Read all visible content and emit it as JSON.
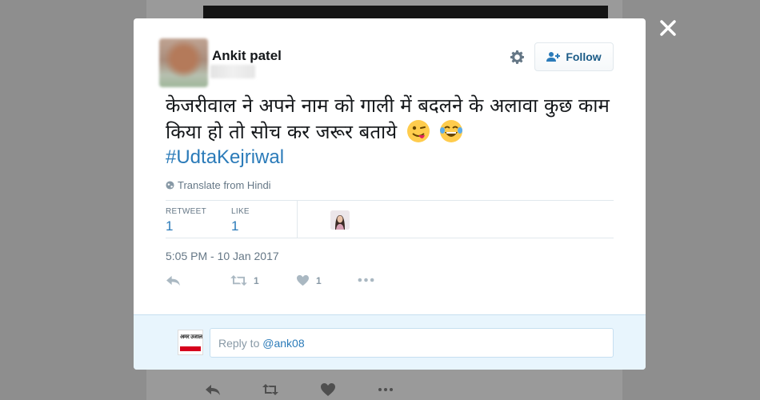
{
  "tweet": {
    "author_name": "Ankit patel",
    "follow_label": "Follow",
    "text": "केजरीवाल ने अपने नाम को गाली में बदलने के अलावा कुछ काम किया हो तो सोच कर जरूर बताये",
    "emojis": [
      "winking-tongue-emoji",
      "tears-of-joy-emoji"
    ],
    "hashtag": "#UdtaKejriwal",
    "translate_label": "Translate from Hindi",
    "stats": {
      "retweet_label": "RETWEET",
      "retweet_count": "1",
      "like_label": "LIKE",
      "like_count": "1"
    },
    "timestamp": "5:05 PM - 10 Jan 2017",
    "actions": {
      "retweet_count": "1",
      "like_count": "1"
    }
  },
  "reply": {
    "prefix": "Reply to ",
    "handle": "@ank08"
  },
  "current_user_avatar": {
    "logo_text": "अमर उजाला"
  },
  "icons": [
    "close-icon",
    "gear-icon",
    "follow-person-icon",
    "globe-icon",
    "reply-icon",
    "retweet-icon",
    "heart-icon",
    "more-icon"
  ],
  "colors": {
    "link": "#2b7bb9",
    "muted": "#657786",
    "reply_bg": "#e8f5fd",
    "overlay": "#8e8e8e"
  }
}
